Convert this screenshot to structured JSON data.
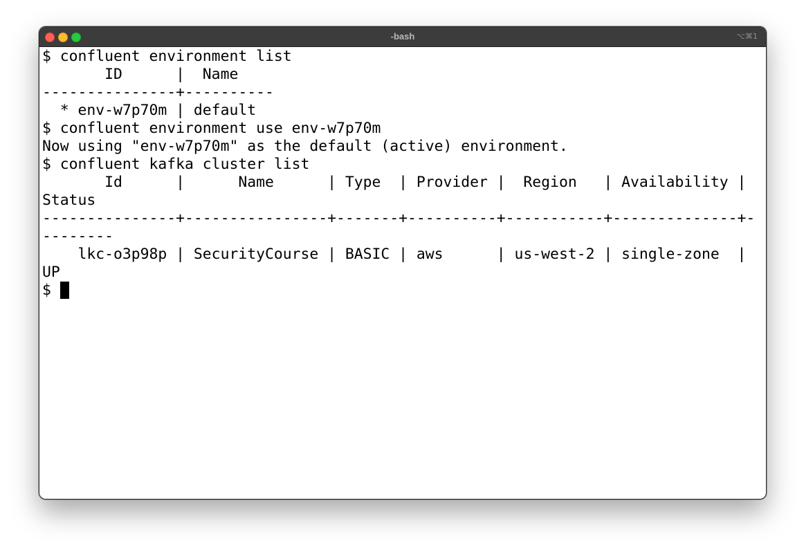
{
  "window": {
    "title": "-bash",
    "shortcut": "⌥⌘1"
  },
  "terminal": {
    "lines": [
      "$ confluent environment list",
      "       ID      |  Name",
      "---------------+----------",
      "  * env-w7p70m | default",
      "$ confluent environment use env-w7p70m",
      "Now using \"env-w7p70m\" as the default (active) environment.",
      "$ confluent kafka cluster list",
      "       Id      |      Name      | Type  | Provider |  Region   | Availability |",
      "Status",
      "---------------+----------------+-------+----------+-----------+--------------+-",
      "--------",
      "    lkc-o3p98p | SecurityCourse | BASIC | aws      | us-west-2 | single-zone  |",
      "UP"
    ],
    "prompt": "$ "
  }
}
